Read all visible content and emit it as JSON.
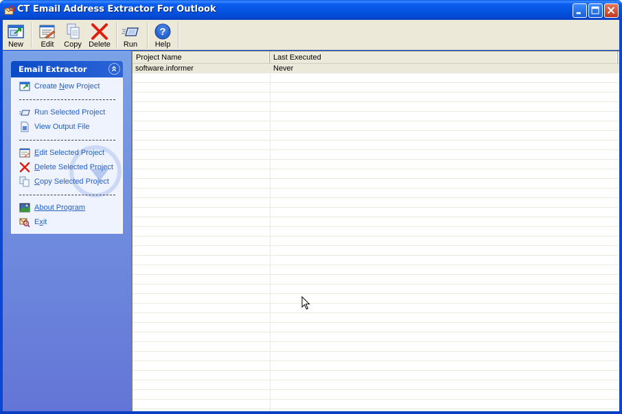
{
  "window": {
    "title": "CT Email Address Extractor For Outlook",
    "controls": [
      "minimize",
      "maximize",
      "close"
    ]
  },
  "toolbar": {
    "buttons": [
      {
        "label": "New",
        "icon": "new-project-icon"
      },
      {
        "label": "Edit",
        "icon": "edit-icon"
      },
      {
        "label": "Copy",
        "icon": "copy-icon"
      },
      {
        "label": "Delete",
        "icon": "delete-icon"
      },
      {
        "label": "Run",
        "icon": "run-icon"
      },
      {
        "label": "Help",
        "icon": "help-icon"
      }
    ]
  },
  "taskpanel": {
    "title": "Email Extractor",
    "groups": [
      [
        {
          "label": "Create New Project",
          "icon": "new-project-icon",
          "accel_char": "N"
        }
      ],
      [
        {
          "label": "Run Selected Project",
          "icon": "run-icon"
        },
        {
          "label": "View Output File",
          "icon": "file-icon"
        }
      ],
      [
        {
          "label": "Edit Selected Project",
          "icon": "edit-icon",
          "accel_char": "E"
        },
        {
          "label": "Delete Selected Project",
          "icon": "delete-icon",
          "accel_char": "D"
        },
        {
          "label": "Copy Selected Project",
          "icon": "copy-icon",
          "accel_char": "C"
        }
      ],
      [
        {
          "label": "About Program",
          "icon": "about-icon"
        },
        {
          "label": "Exit",
          "icon": "exit-icon",
          "accel_char": "x"
        }
      ]
    ]
  },
  "projects": {
    "columns": [
      "Project Name",
      "Last Executed"
    ],
    "rows": [
      {
        "name": "software.informer",
        "last_executed": "Never",
        "selected": true
      }
    ]
  }
}
